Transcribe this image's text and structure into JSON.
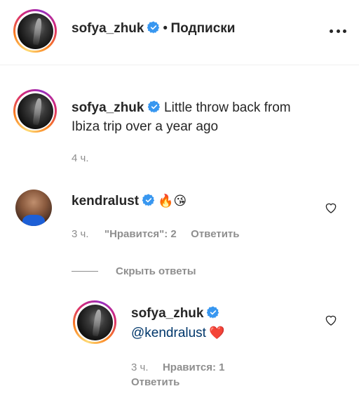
{
  "header": {
    "username": "sofya_zhuk",
    "separator": "•",
    "follow_label": "Подписки"
  },
  "caption": {
    "username": "sofya_zhuk",
    "text_line1": "Little throw back from",
    "text_line2": "Ibiza trip over a year ago",
    "time": "4 ч."
  },
  "comments": [
    {
      "username": "kendralust",
      "emojis": [
        "🔥",
        "😘"
      ],
      "time": "3 ч.",
      "likes_label": "\"Нравится\": 2",
      "reply_label": "Ответить"
    }
  ],
  "hide_replies_label": "Скрыть ответы",
  "reply": {
    "username": "sofya_zhuk",
    "mention": "@kendralust",
    "emoji": "❤️",
    "time": "3 ч.",
    "likes_label": "Нравится: 1",
    "reply_label": "Ответить"
  },
  "colors": {
    "text": "#262626",
    "secondary": "#8e8e8e",
    "verified": "#3897f0",
    "mention": "#00376b",
    "divider": "#efefef"
  },
  "icons": {
    "verified": "verified-badge-icon",
    "more": "more-options-icon",
    "like": "heart-outline-icon"
  }
}
